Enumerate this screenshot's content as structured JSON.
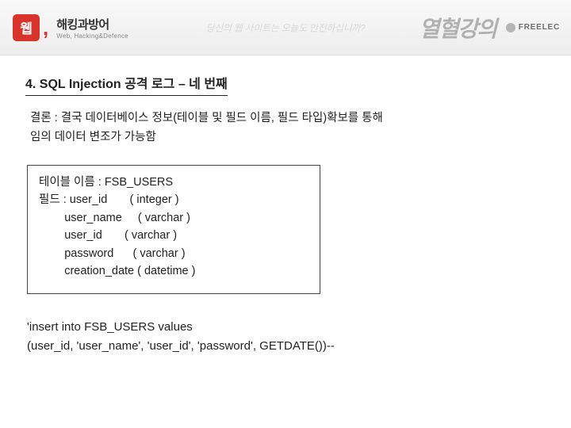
{
  "header": {
    "logo_box": "웹",
    "logo_comma": ",",
    "logo_main": "해킹과방어",
    "logo_sub": "Web, Hacking&Defence",
    "center_faded": "당신의 웹 사이트는 오늘도 안전하십니까?",
    "calligraphy": "열혈강의",
    "freelec": "FREELEC"
  },
  "section_title": "4. SQL Injection 공격 로그 – 네 번째",
  "conclusion_line1": "결론 : 결국 데이터베이스 정보(테이블 및 필드 이름, 필드 타입)확보를 통해",
  "conclusion_line2": "임의 데이터 변조가 가능함",
  "schema": {
    "table_label": "테이블 이름 : ",
    "table_name": "FSB_USERS",
    "field_label": "필드 : ",
    "fields": [
      {
        "name": "user_id",
        "type": "( integer )"
      },
      {
        "name": "user_name",
        "type": "( varchar )"
      },
      {
        "name": "user_id",
        "type": "( varchar )"
      },
      {
        "name": "password",
        "type": "( varchar )"
      },
      {
        "name": "creation_date",
        "type": "( datetime )"
      }
    ]
  },
  "sql_line1": "'insert into FSB_USERS values",
  "sql_line2": "(user_id, 'user_name', 'user_id', 'password', GETDATE())--"
}
